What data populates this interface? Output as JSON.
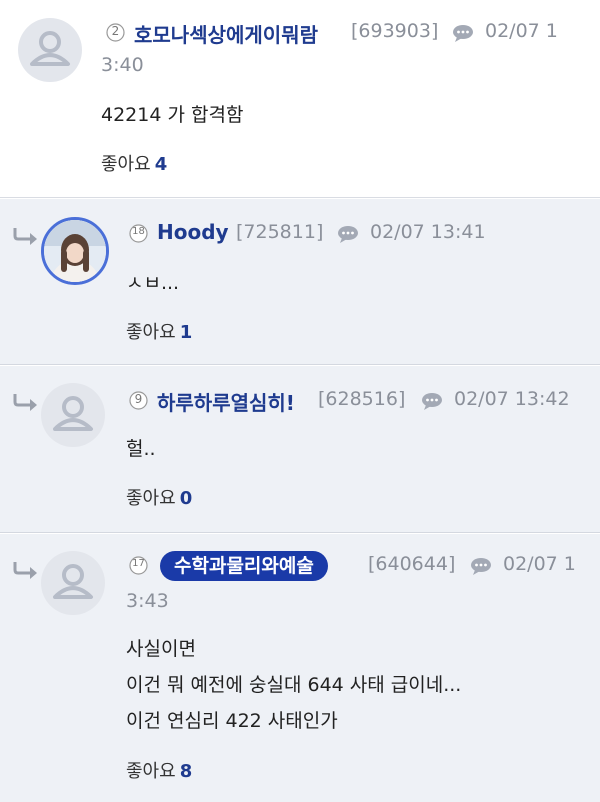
{
  "comments": [
    {
      "level": "2",
      "nickname": "호모나섹상에게이뭐람",
      "user_id": "[693903]",
      "time": "02/07 1",
      "time_cont": "3:40",
      "body": [
        "42214 가 합격함"
      ],
      "like_label": "좋아요",
      "like_count": "4",
      "avatar": "default-avatar"
    },
    {
      "level": "18",
      "nickname": "Hoody",
      "user_id": "[725811]",
      "time": "02/07 13:41",
      "body": [
        "ㅅㅂ..."
      ],
      "like_label": "좋아요",
      "like_count": "1",
      "avatar": "photo-avatar"
    },
    {
      "level": "9",
      "nickname": "하루하루열심히!",
      "user_id": "[628516]",
      "time": "02/07 13:42",
      "body": [
        "헐.."
      ],
      "like_label": "좋아요",
      "like_count": "0",
      "avatar": "default-avatar"
    },
    {
      "level": "17",
      "nickname": "수학과물리와예술",
      "user_id": "[640644]",
      "time": "02/07 1",
      "time_cont": "3:43",
      "body": [
        "사실이면",
        "이건 뭐 예전에 숭실대 644 사태 급이네...",
        "이건 연심리 422 사태인가"
      ],
      "like_label": "좋아요",
      "like_count": "8",
      "avatar": "default-avatar"
    }
  ],
  "colors": {
    "nickname": "#1f3b8f",
    "nickname_pill_bg": "#1a3aa8",
    "meta_gray": "#8a8f99",
    "reply_bg": "#eef1f6",
    "reply_arrow": "#9aa0ab"
  },
  "icons": [
    "reply-arrow-icon",
    "default-avatar-icon",
    "level-badge-icon",
    "speech-bubble-icon"
  ]
}
